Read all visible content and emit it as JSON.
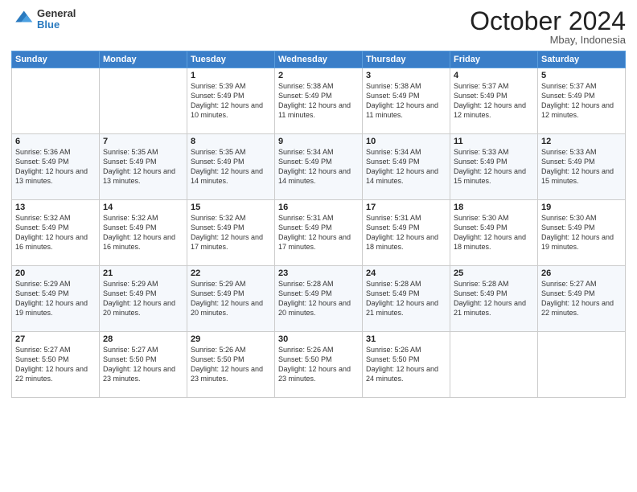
{
  "header": {
    "logo_general": "General",
    "logo_blue": "Blue",
    "month_title": "October 2024",
    "location": "Mbay, Indonesia"
  },
  "days_of_week": [
    "Sunday",
    "Monday",
    "Tuesday",
    "Wednesday",
    "Thursday",
    "Friday",
    "Saturday"
  ],
  "weeks": [
    [
      {
        "day": "",
        "sunrise": "",
        "sunset": "",
        "daylight": ""
      },
      {
        "day": "",
        "sunrise": "",
        "sunset": "",
        "daylight": ""
      },
      {
        "day": "1",
        "sunrise": "Sunrise: 5:39 AM",
        "sunset": "Sunset: 5:49 PM",
        "daylight": "Daylight: 12 hours and 10 minutes."
      },
      {
        "day": "2",
        "sunrise": "Sunrise: 5:38 AM",
        "sunset": "Sunset: 5:49 PM",
        "daylight": "Daylight: 12 hours and 11 minutes."
      },
      {
        "day": "3",
        "sunrise": "Sunrise: 5:38 AM",
        "sunset": "Sunset: 5:49 PM",
        "daylight": "Daylight: 12 hours and 11 minutes."
      },
      {
        "day": "4",
        "sunrise": "Sunrise: 5:37 AM",
        "sunset": "Sunset: 5:49 PM",
        "daylight": "Daylight: 12 hours and 12 minutes."
      },
      {
        "day": "5",
        "sunrise": "Sunrise: 5:37 AM",
        "sunset": "Sunset: 5:49 PM",
        "daylight": "Daylight: 12 hours and 12 minutes."
      }
    ],
    [
      {
        "day": "6",
        "sunrise": "Sunrise: 5:36 AM",
        "sunset": "Sunset: 5:49 PM",
        "daylight": "Daylight: 12 hours and 13 minutes."
      },
      {
        "day": "7",
        "sunrise": "Sunrise: 5:35 AM",
        "sunset": "Sunset: 5:49 PM",
        "daylight": "Daylight: 12 hours and 13 minutes."
      },
      {
        "day": "8",
        "sunrise": "Sunrise: 5:35 AM",
        "sunset": "Sunset: 5:49 PM",
        "daylight": "Daylight: 12 hours and 14 minutes."
      },
      {
        "day": "9",
        "sunrise": "Sunrise: 5:34 AM",
        "sunset": "Sunset: 5:49 PM",
        "daylight": "Daylight: 12 hours and 14 minutes."
      },
      {
        "day": "10",
        "sunrise": "Sunrise: 5:34 AM",
        "sunset": "Sunset: 5:49 PM",
        "daylight": "Daylight: 12 hours and 14 minutes."
      },
      {
        "day": "11",
        "sunrise": "Sunrise: 5:33 AM",
        "sunset": "Sunset: 5:49 PM",
        "daylight": "Daylight: 12 hours and 15 minutes."
      },
      {
        "day": "12",
        "sunrise": "Sunrise: 5:33 AM",
        "sunset": "Sunset: 5:49 PM",
        "daylight": "Daylight: 12 hours and 15 minutes."
      }
    ],
    [
      {
        "day": "13",
        "sunrise": "Sunrise: 5:32 AM",
        "sunset": "Sunset: 5:49 PM",
        "daylight": "Daylight: 12 hours and 16 minutes."
      },
      {
        "day": "14",
        "sunrise": "Sunrise: 5:32 AM",
        "sunset": "Sunset: 5:49 PM",
        "daylight": "Daylight: 12 hours and 16 minutes."
      },
      {
        "day": "15",
        "sunrise": "Sunrise: 5:32 AM",
        "sunset": "Sunset: 5:49 PM",
        "daylight": "Daylight: 12 hours and 17 minutes."
      },
      {
        "day": "16",
        "sunrise": "Sunrise: 5:31 AM",
        "sunset": "Sunset: 5:49 PM",
        "daylight": "Daylight: 12 hours and 17 minutes."
      },
      {
        "day": "17",
        "sunrise": "Sunrise: 5:31 AM",
        "sunset": "Sunset: 5:49 PM",
        "daylight": "Daylight: 12 hours and 18 minutes."
      },
      {
        "day": "18",
        "sunrise": "Sunrise: 5:30 AM",
        "sunset": "Sunset: 5:49 PM",
        "daylight": "Daylight: 12 hours and 18 minutes."
      },
      {
        "day": "19",
        "sunrise": "Sunrise: 5:30 AM",
        "sunset": "Sunset: 5:49 PM",
        "daylight": "Daylight: 12 hours and 19 minutes."
      }
    ],
    [
      {
        "day": "20",
        "sunrise": "Sunrise: 5:29 AM",
        "sunset": "Sunset: 5:49 PM",
        "daylight": "Daylight: 12 hours and 19 minutes."
      },
      {
        "day": "21",
        "sunrise": "Sunrise: 5:29 AM",
        "sunset": "Sunset: 5:49 PM",
        "daylight": "Daylight: 12 hours and 20 minutes."
      },
      {
        "day": "22",
        "sunrise": "Sunrise: 5:29 AM",
        "sunset": "Sunset: 5:49 PM",
        "daylight": "Daylight: 12 hours and 20 minutes."
      },
      {
        "day": "23",
        "sunrise": "Sunrise: 5:28 AM",
        "sunset": "Sunset: 5:49 PM",
        "daylight": "Daylight: 12 hours and 20 minutes."
      },
      {
        "day": "24",
        "sunrise": "Sunrise: 5:28 AM",
        "sunset": "Sunset: 5:49 PM",
        "daylight": "Daylight: 12 hours and 21 minutes."
      },
      {
        "day": "25",
        "sunrise": "Sunrise: 5:28 AM",
        "sunset": "Sunset: 5:49 PM",
        "daylight": "Daylight: 12 hours and 21 minutes."
      },
      {
        "day": "26",
        "sunrise": "Sunrise: 5:27 AM",
        "sunset": "Sunset: 5:49 PM",
        "daylight": "Daylight: 12 hours and 22 minutes."
      }
    ],
    [
      {
        "day": "27",
        "sunrise": "Sunrise: 5:27 AM",
        "sunset": "Sunset: 5:50 PM",
        "daylight": "Daylight: 12 hours and 22 minutes."
      },
      {
        "day": "28",
        "sunrise": "Sunrise: 5:27 AM",
        "sunset": "Sunset: 5:50 PM",
        "daylight": "Daylight: 12 hours and 23 minutes."
      },
      {
        "day": "29",
        "sunrise": "Sunrise: 5:26 AM",
        "sunset": "Sunset: 5:50 PM",
        "daylight": "Daylight: 12 hours and 23 minutes."
      },
      {
        "day": "30",
        "sunrise": "Sunrise: 5:26 AM",
        "sunset": "Sunset: 5:50 PM",
        "daylight": "Daylight: 12 hours and 23 minutes."
      },
      {
        "day": "31",
        "sunrise": "Sunrise: 5:26 AM",
        "sunset": "Sunset: 5:50 PM",
        "daylight": "Daylight: 12 hours and 24 minutes."
      },
      {
        "day": "",
        "sunrise": "",
        "sunset": "",
        "daylight": ""
      },
      {
        "day": "",
        "sunrise": "",
        "sunset": "",
        "daylight": ""
      }
    ]
  ]
}
